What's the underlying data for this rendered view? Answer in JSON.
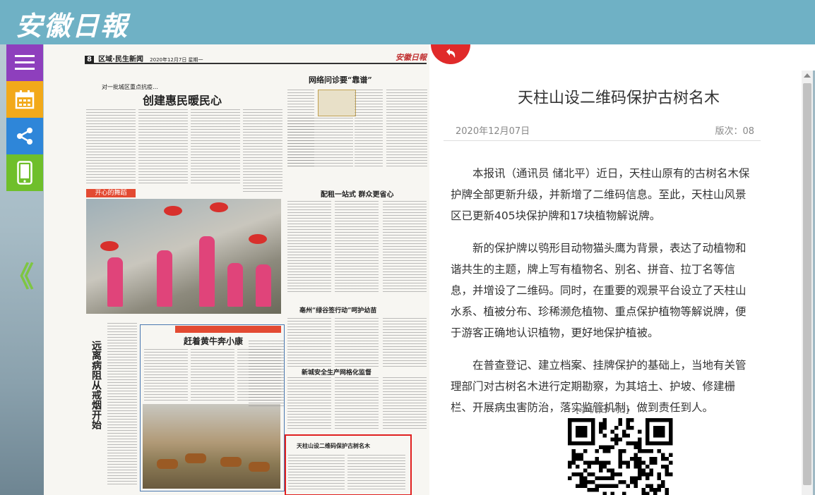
{
  "header": {
    "logo_text": "安徽日報"
  },
  "sidebar": {
    "items": [
      {
        "name": "menu",
        "icon": "hamburger-menu-icon",
        "color": "#8e3fbd"
      },
      {
        "name": "calendar",
        "icon": "calendar-icon",
        "color": "#f2a91a"
      },
      {
        "name": "share",
        "icon": "share-icon",
        "color": "#2e86d9"
      },
      {
        "name": "mobile",
        "icon": "mobile-phone-icon",
        "color": "#6fbf2b"
      }
    ],
    "prev_page": "《"
  },
  "newspaper": {
    "page_label": "8",
    "section": "区域·民生新闻",
    "date_line": "2020年12月7日 星期一",
    "logo": "安徽日報",
    "headlines": {
      "main": "创建惠民暖民心",
      "kicker": "对一批城区重点抗疫…",
      "net": "网络问诊要“靠谱”",
      "fuel": "配租一站式 群众更省心",
      "green": "亳州“绿谷签行动”呵护幼苗",
      "left_vertical": "远离病阻从戒烟开始",
      "cattle": "赶着黄牛奔小康",
      "safety": "新城安全生产网格化监督",
      "trees": "天柱山设二维码保护古树名木"
    },
    "photo_ribbon": "开心的舞蹈"
  },
  "article": {
    "back_icon": "return-arrow-icon",
    "title": "天柱山设二维码保护古树名木",
    "date": "2020年12月07日",
    "version": "版次：08",
    "paragraphs": [
      "本报讯（通讯员 储北平）近日，天柱山原有的古树名木保护牌全部更新升级，并新增了二维码信息。至此，天柱山风景区已更新405块保护牌和17块植物解说牌。",
      "新的保护牌以鸮形目动物猫头鹰为背景，表达了动植物和谐共生的主题，牌上写有植物名、别名、拼音、拉丁名等信息，并增设了二维码。同时，在重要的观景平台设立了天柱山水系、植被分布、珍稀濒危植物、重点保护植物等解说牌，便于游客正确地认识植物，更好地保护植被。",
      "在普查登记、建立档案、挂牌保护的基础上，当地有关管理部门对古树名木进行定期勘察，为其培土、护坡、修建栅栏、开展病虫害防治，落实监管机制，做到责任到人。"
    ],
    "scan_label": "[手机扫一扫]"
  }
}
